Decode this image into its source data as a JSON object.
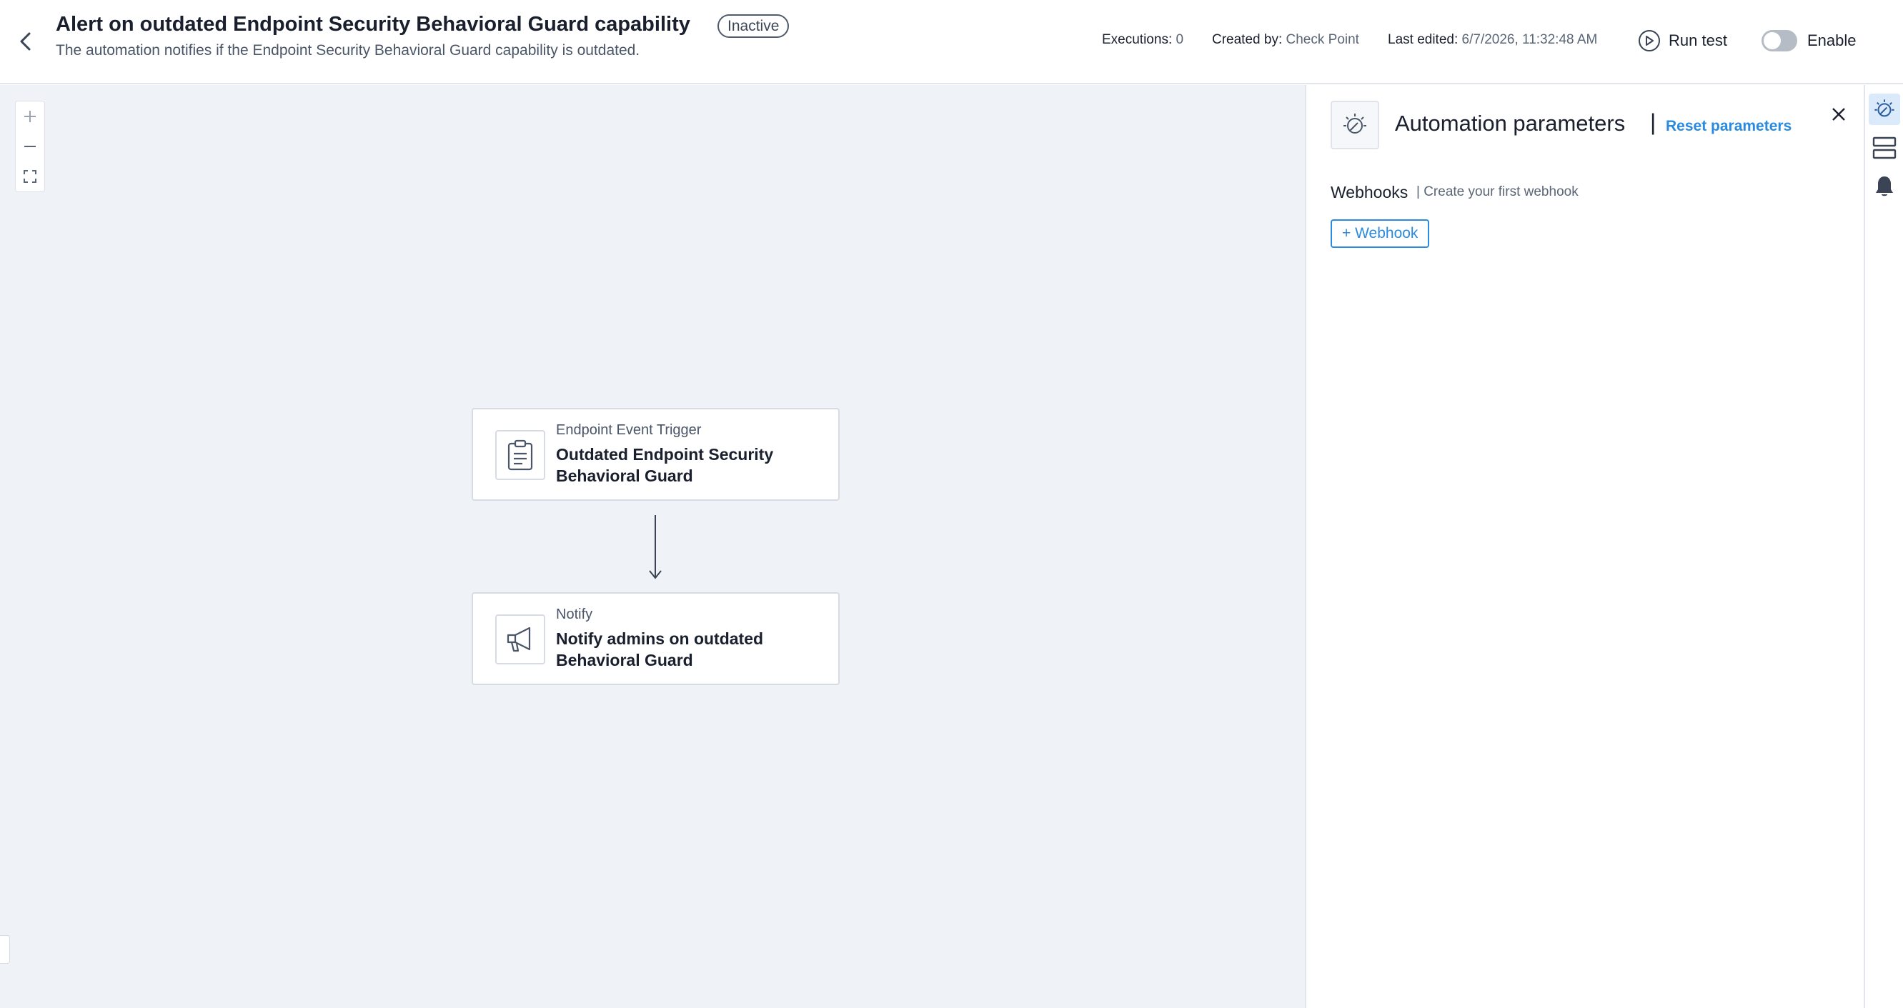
{
  "header": {
    "title": "Alert on outdated Endpoint Security Behavioral Guard capability",
    "status": "Inactive",
    "subtitle": "The automation notifies if the Endpoint Security Behavioral Guard capability is outdated.",
    "executions_label": "Executions:",
    "executions_value": "0",
    "created_by_label": "Created by:",
    "created_by_value": "Check Point",
    "last_edited_label": "Last edited:",
    "last_edited_value": "6/7/2026, 11:32:48 AM",
    "run_test_label": "Run test",
    "enable_label": "Enable",
    "enabled": false
  },
  "canvas": {
    "zoom_controls": [
      "zoom-in",
      "zoom-out",
      "fit-to-screen"
    ],
    "nodes": [
      {
        "type": "Endpoint Event Trigger",
        "name": "Outdated Endpoint Security Behavioral Guard",
        "icon": "clipboard-icon"
      },
      {
        "type": "Notify",
        "name": "Notify admins on outdated Behavioral Guard",
        "icon": "megaphone-icon"
      }
    ]
  },
  "panel": {
    "title": "Automation parameters",
    "separator": "|",
    "reset_label": "Reset parameters",
    "webhooks_label": "Webhooks",
    "webhooks_hint": "| Create your first webhook",
    "add_webhook_label": "+ Webhook"
  },
  "rail": {
    "items": [
      "automation-parameters-icon",
      "layout-rows-icon",
      "bell-icon"
    ],
    "active": "automation-parameters-icon"
  },
  "colors": {
    "accent": "#2a8ae0",
    "canvas_bg": "#eff2f7",
    "rail_active_bg": "#dbeafb",
    "toggle_off": "#b6bcc6"
  }
}
